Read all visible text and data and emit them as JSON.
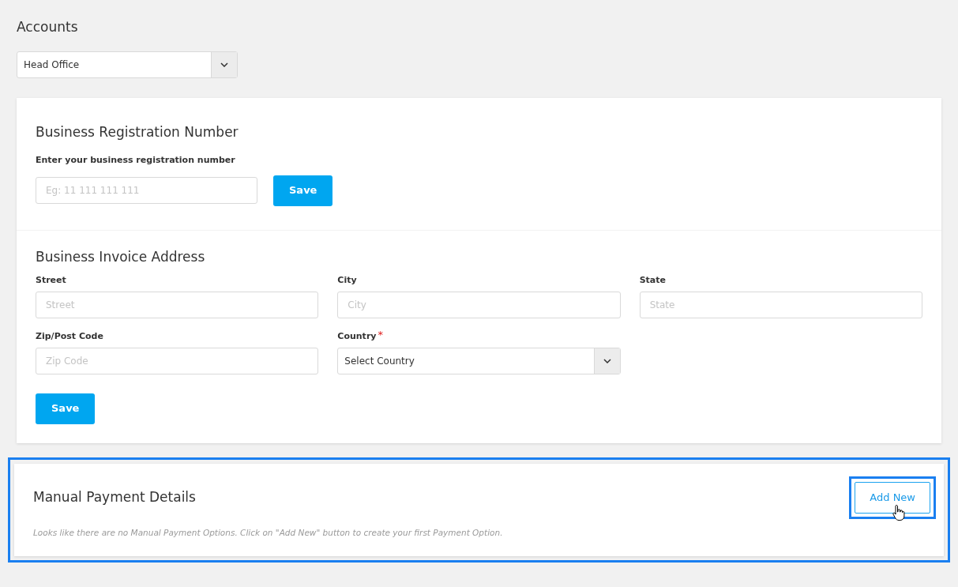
{
  "page_title": "Accounts",
  "account_select": {
    "value": "Head Office"
  },
  "registration": {
    "title": "Business Registration Number",
    "label": "Enter your business registration number",
    "placeholder": "Eg: 11 111 111 111",
    "button": "Save"
  },
  "invoice_address": {
    "title": "Business Invoice Address",
    "fields": [
      {
        "kind": "input",
        "label": "Street",
        "placeholder": "Street"
      },
      {
        "kind": "input",
        "label": "City",
        "placeholder": "City"
      },
      {
        "kind": "input",
        "label": "State",
        "placeholder": "State"
      },
      {
        "kind": "input",
        "label": "Zip/Post Code",
        "placeholder": "Zip Code"
      },
      {
        "kind": "select",
        "label": "Country",
        "value": "Select Country",
        "required_mark": "*"
      }
    ],
    "button": "Save"
  },
  "manual_payment": {
    "title": "Manual Payment Details",
    "highlighted": true,
    "button": {
      "label": "Add New",
      "highlighted": true
    },
    "empty_message": "Looks like there are no Manual Payment Options. Click on \"Add New\" button to create your first Payment Option."
  }
}
